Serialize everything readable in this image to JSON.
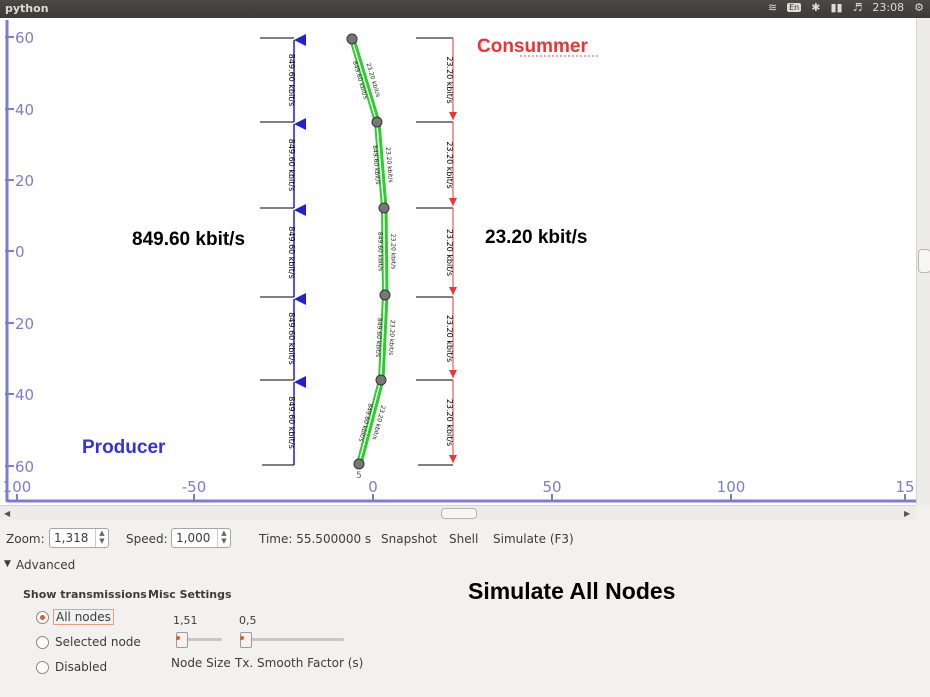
{
  "window": {
    "title": "python",
    "time": "23:08",
    "keyboard": "En"
  },
  "canvas": {
    "y_ticks": [
      "60",
      "40",
      "20",
      "0",
      "20",
      "40",
      "60"
    ],
    "x_ticks": [
      "100",
      "-50",
      "0",
      "50",
      "100",
      "15"
    ],
    "labels": {
      "consumer": "Consummer",
      "producer": "Producer",
      "left_rate": "849.60 kbit/s",
      "right_rate": "23.20 kbit/s"
    },
    "link_rate_left": "849.60 kbit/s",
    "link_rate_right": "23.20 kbit/s",
    "node_bottom_id": "5",
    "colors": {
      "axis": "#8f8fd6",
      "producer": "#3333dd",
      "consumer": "#ee2222",
      "link": "#2ecc2e",
      "node": "#777777"
    }
  },
  "controls": {
    "zoom_label": "Zoom:",
    "zoom_value": "1,318",
    "speed_label": "Speed:",
    "speed_value": "1,000",
    "time_text": "Time: 55.500000 s",
    "snapshot": "Snapshot",
    "shell": "Shell",
    "simulate": "Simulate (F3)",
    "advanced": "Advanced"
  },
  "advanced": {
    "show_transmissions": "Show transmissions",
    "radio_options": [
      "All nodes",
      "Selected node",
      "Disabled"
    ],
    "selected": "All nodes",
    "misc_settings": "Misc Settings",
    "node_size_value": "1,51",
    "node_size_label": "Node Size",
    "smooth_value": "0,5",
    "smooth_label": "Tx. Smooth Factor (s)"
  },
  "annotation": "Simulate All Nodes"
}
